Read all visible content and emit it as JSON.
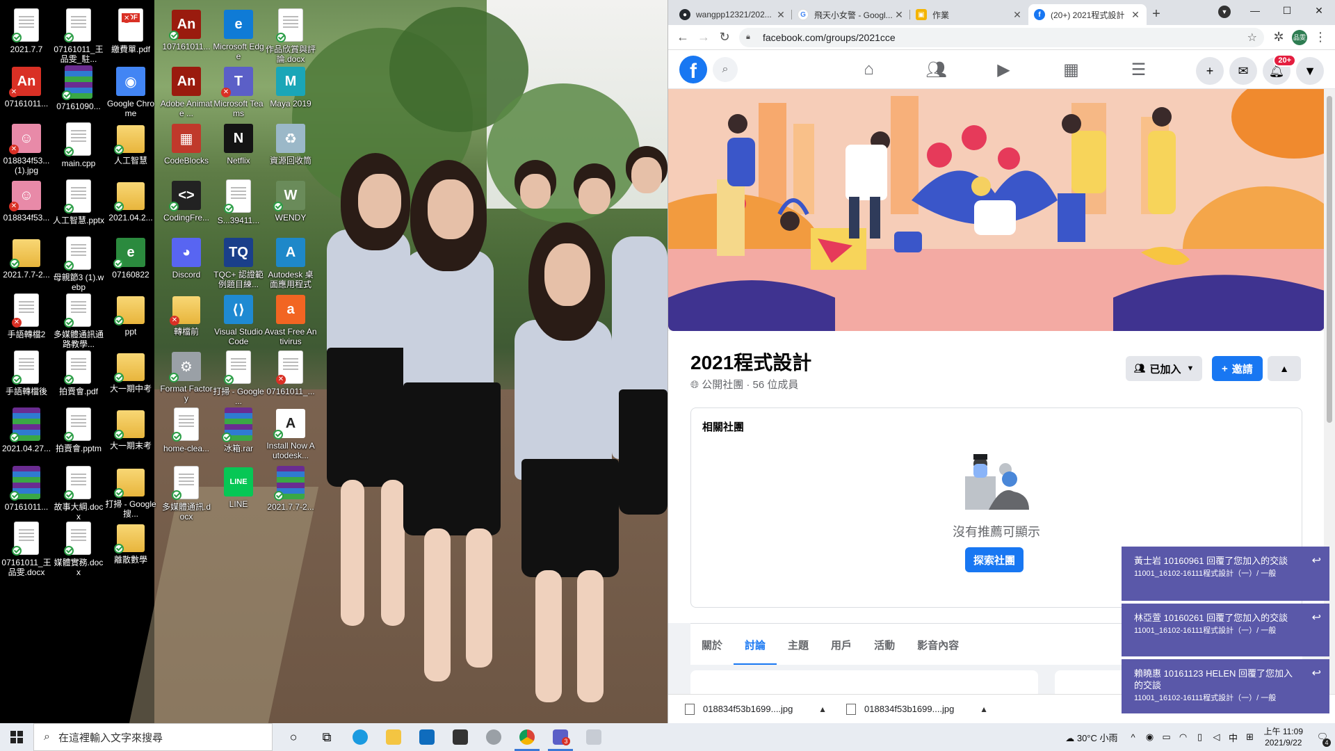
{
  "desktop": {
    "icons": [
      {
        "label": "2021.7.7",
        "kind": "doc",
        "status": "ok"
      },
      {
        "label": "07161011_王品雯_駐...",
        "kind": "doc",
        "status": "ok"
      },
      {
        "label": "繳費單.pdf",
        "kind": "pdf",
        "status": "x",
        "badge": "PDF"
      },
      {
        "label": "07161011...",
        "kind": "app",
        "status": "x",
        "color": "#d93025",
        "glyph": "An"
      },
      {
        "label": "07161090...",
        "kind": "rar",
        "status": "ok"
      },
      {
        "label": "Google Chrome",
        "kind": "app",
        "status": "none",
        "color": "#4285f4",
        "glyph": "◉"
      },
      {
        "label": "018834f53...(1).jpg",
        "kind": "app",
        "status": "x",
        "color": "#e88aa8",
        "glyph": "☺"
      },
      {
        "label": "main.cpp",
        "kind": "doc",
        "status": "ok"
      },
      {
        "label": "人工智慧",
        "kind": "folder",
        "status": "ok"
      },
      {
        "label": "018834f53...",
        "kind": "app",
        "status": "x",
        "color": "#e88aa8",
        "glyph": "☺"
      },
      {
        "label": "人工智慧.pptx",
        "kind": "doc",
        "status": "ok"
      },
      {
        "label": "2021.04.2...",
        "kind": "folder",
        "status": "ok"
      },
      {
        "label": "2021.7.7-2...",
        "kind": "folder",
        "status": "ok"
      },
      {
        "label": "母親節3 (1).webp",
        "kind": "doc",
        "status": "ok"
      },
      {
        "label": "07160822",
        "kind": "app",
        "status": "ok",
        "color": "#2b8a3e",
        "glyph": "e"
      },
      {
        "label": "手語轉檔2",
        "kind": "doc",
        "status": "x"
      },
      {
        "label": "多媒體通訊通路教學...",
        "kind": "doc",
        "status": "ok"
      },
      {
        "label": "ppt",
        "kind": "folder",
        "status": "ok"
      },
      {
        "label": "手語轉檔後",
        "kind": "doc",
        "status": "ok"
      },
      {
        "label": "拍賣會.pdf",
        "kind": "doc",
        "status": "ok"
      },
      {
        "label": "大一期中考",
        "kind": "folder",
        "status": "ok"
      },
      {
        "label": "2021.04.27...",
        "kind": "rar",
        "status": "ok"
      },
      {
        "label": "拍賣會.pptm",
        "kind": "doc",
        "status": "ok"
      },
      {
        "label": "大一期末考",
        "kind": "folder",
        "status": "ok"
      },
      {
        "label": "07161011...",
        "kind": "rar",
        "status": "ok"
      },
      {
        "label": "故事大綱.docx",
        "kind": "doc",
        "status": "ok"
      },
      {
        "label": "打掃 - Google 搜...",
        "kind": "folder",
        "status": "ok"
      },
      {
        "label": "07161011_王品雯.docx",
        "kind": "doc",
        "status": "ok"
      },
      {
        "label": "媒體實務.docx",
        "kind": "doc",
        "status": "ok"
      },
      {
        "label": "離散數學",
        "kind": "folder",
        "status": "ok"
      },
      {
        "label": "107161011...",
        "kind": "app",
        "status": "ok",
        "color": "#9a1b0e",
        "glyph": "An"
      },
      {
        "label": "Microsoft Edge",
        "kind": "app",
        "status": "none",
        "color": "#0f7bd6",
        "glyph": "e"
      },
      {
        "label": "作品欣賞與評論.docx",
        "kind": "doc",
        "status": "ok"
      },
      {
        "label": "Adobe Animate ...",
        "kind": "app",
        "status": "none",
        "color": "#9a1b0e",
        "glyph": "An"
      },
      {
        "label": "Microsoft Teams",
        "kind": "app",
        "status": "x",
        "color": "#5b5fc7",
        "glyph": "T"
      },
      {
        "label": "Maya 2019",
        "kind": "app",
        "status": "none",
        "color": "#1aa6b7",
        "glyph": "M"
      },
      {
        "label": "CodeBlocks",
        "kind": "app",
        "status": "none",
        "color": "#c0392b",
        "glyph": "▦"
      },
      {
        "label": "Netflix",
        "kind": "app",
        "status": "none",
        "color": "#141414",
        "glyph": "N"
      },
      {
        "label": "資源回收筒",
        "kind": "app",
        "status": "none",
        "color": "#9bb8c8",
        "glyph": "♻"
      },
      {
        "label": "CodingFre...",
        "kind": "app",
        "status": "ok",
        "color": "#222",
        "glyph": "<>"
      },
      {
        "label": "S...39411...",
        "kind": "doc",
        "status": "ok"
      },
      {
        "label": "WENDY",
        "kind": "app",
        "status": "ok",
        "color": "#6a8b5a",
        "glyph": "W"
      },
      {
        "label": "Discord",
        "kind": "app",
        "status": "none",
        "color": "#5865f2",
        "glyph": "◕"
      },
      {
        "label": "TQC+ 認證範例題目練...",
        "kind": "app",
        "status": "none",
        "color": "#1a3f8a",
        "glyph": "TQ"
      },
      {
        "label": "Autodesk 桌面應用程式",
        "kind": "app",
        "status": "none",
        "color": "#1e88c9",
        "glyph": "A"
      },
      {
        "label": "轉檔前",
        "kind": "folder",
        "status": "x"
      },
      {
        "label": "Visual Studio Code",
        "kind": "app",
        "status": "none",
        "color": "#1f8ad2",
        "glyph": "⟨⟩"
      },
      {
        "label": "Avast Free Antivirus",
        "kind": "app",
        "status": "none",
        "color": "#f26522",
        "glyph": "a"
      },
      {
        "label": "Format Factory",
        "kind": "app",
        "status": "ok",
        "color": "#9aa0a6",
        "glyph": "⚙"
      },
      {
        "label": "打掃 - Google ...",
        "kind": "doc",
        "status": "ok"
      },
      {
        "label": "07161011_...",
        "kind": "doc",
        "status": "x"
      },
      {
        "label": "home-clea...",
        "kind": "doc",
        "status": "ok"
      },
      {
        "label": "冰箱.rar",
        "kind": "rar",
        "status": "ok"
      },
      {
        "label": "Install Now Autodesk...",
        "kind": "app",
        "status": "ok",
        "color": "#fff",
        "glyph": "A"
      },
      {
        "label": "多媒體通訊.docx",
        "kind": "doc",
        "status": "ok"
      },
      {
        "label": "LINE",
        "kind": "app",
        "status": "none",
        "color": "#06c755",
        "glyph": "LINE"
      },
      {
        "label": "2021.7.7-2...",
        "kind": "rar",
        "status": "ok"
      }
    ]
  },
  "browser": {
    "tabs": [
      {
        "title": "wangpp12321/202...",
        "icon": "github-icon",
        "active": false
      },
      {
        "title": "飛天小女警 - Googl...",
        "icon": "google-icon",
        "active": false
      },
      {
        "title": "作業",
        "icon": "classroom-icon",
        "active": false
      },
      {
        "title": "(20+) 2021程式設計",
        "icon": "facebook-icon",
        "active": true
      }
    ],
    "new_tab": "+",
    "url": "facebook.com/groups/2021cce",
    "profile_initials": "品雯"
  },
  "facebook": {
    "notif_badge": "20+",
    "group": {
      "title": "2021程式設計",
      "meta": "公開社團 · 56 位成員",
      "joined_label": "已加入",
      "invite_label": "邀請"
    },
    "related": {
      "heading": "相關社團",
      "empty_message": "沒有推薦可顯示",
      "explore_label": "探索社團"
    },
    "tabs": [
      "關於",
      "討論",
      "主題",
      "用戶",
      "活動",
      "影音內容"
    ],
    "active_tab": 1
  },
  "downloads": [
    {
      "name": "018834f53b1699....jpg"
    },
    {
      "name": "018834f53b1699....jpg"
    }
  ],
  "notifications": [
    {
      "line1": "黃士岩 10160961 回覆了您加入的交談",
      "line2": "11001_16102-16111程式設計（一）/ 一般"
    },
    {
      "line1": "林亞萱 10160261 回覆了您加入的交談",
      "line2": "11001_16102-16111程式設計（一）/ 一般"
    },
    {
      "line1": "賴曉惠 10161123 HELEN 回覆了您加入的交談",
      "line2": "11001_16102-16111程式設計（一）/ 一般"
    }
  ],
  "taskbar": {
    "search_placeholder": "在這裡輸入文字來搜尋",
    "weather": "30°C 小雨",
    "ime": "中",
    "time": "上午 11:09",
    "date": "2021/9/22",
    "notif_count": "4",
    "teams_badge": "3"
  }
}
